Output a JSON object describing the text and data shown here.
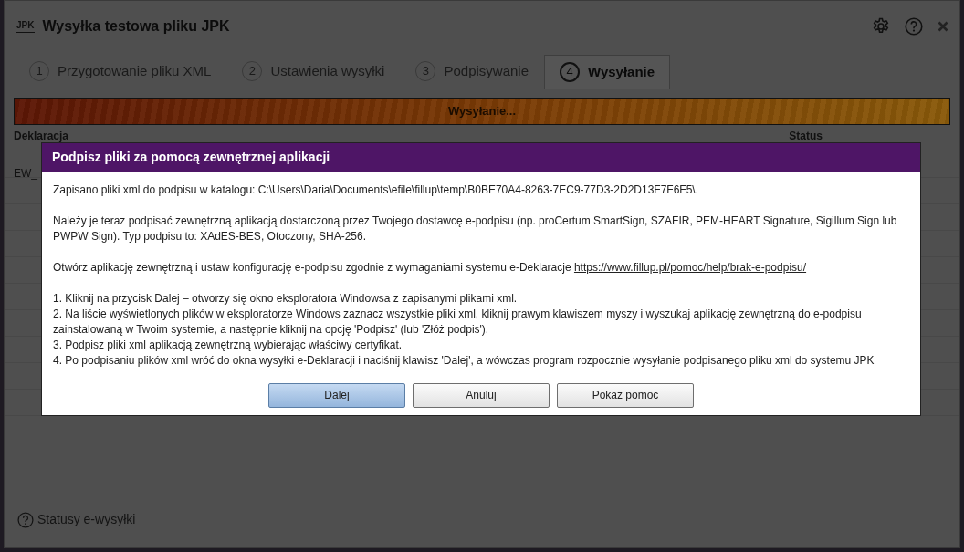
{
  "window": {
    "logo": "JPK",
    "title": "Wysyłka testowa pliku JPK"
  },
  "tabs": [
    {
      "number": "1",
      "label": "Przygotowanie pliku XML",
      "selected": false
    },
    {
      "number": "2",
      "label": "Ustawienia wysyłki",
      "selected": false
    },
    {
      "number": "3",
      "label": "Podpisywanie",
      "selected": false
    },
    {
      "number": "4",
      "label": "Wysyłanie",
      "selected": true
    }
  ],
  "progress": {
    "label": "Wysyłanie...",
    "level": 1
  },
  "table": {
    "columns": [
      "Deklaracja",
      "Status"
    ],
    "rows": [
      {
        "column_1": "EW_"
      }
    ]
  },
  "footer_link": "Statusy e-wysyłki",
  "dialog": {
    "title": "Podpisz pliki za pomocą zewnętrznej aplikacji",
    "paragraphs": [
      {
        "text": "Zapisano pliki xml do podpisu w katalogu: C:\\Users\\Daria\\Documents\\efile\\fillup\\temp\\B0BE70A4-8263-7EC9-77D3-2D2D13F7F6F5\\."
      },
      {
        "text": "Należy je teraz podpisać zewnętrzną aplikacją dostarczoną przez Twojego dostawcę e-podpisu (np. proCertum SmartSign, SZAFIR, PEM-HEART Signature, Sigillum Sign lub PWPW Sign). Typ podpisu to: XAdES-BES, Otoczony, SHA-256."
      },
      {
        "text": "Otwórz aplikację zewnętrzną i ustaw konfigurację e-podpisu zgodnie z wymaganiami systemu e-Deklaracje",
        "link": "https://www.fillup.pl/pomoc/help/brak-e-podpisu/"
      }
    ],
    "steps": [
      "1. Kliknij na przycisk Dalej – otworzy się okno eksploratora Windowsa z zapisanymi plikami xml.",
      "2. Na liście wyświetlonych plików w eksploratorze Windows zaznacz wszystkie pliki xml, kliknij prawym klawiszem myszy i wyszukaj aplikację zewnętrzną do e-podpisu zainstalowaną w Twoim systemie, a następnie kliknij na opcję 'Podpisz' (lub 'Złóż podpis').",
      "3. Podpisz pliki xml aplikacją zewnętrzną wybierając właściwy certyfikat.",
      "4. Po podpisaniu plików xml wróć do okna wysyłki e-Deklaracji i naciśnij klawisz 'Dalej', a wówczas program rozpocznie wysyłanie podpisanego pliku xml do systemu JPK"
    ],
    "buttons": [
      {
        "label": "Dalej",
        "primary": true
      },
      {
        "label": "Anuluj",
        "primary": false
      },
      {
        "label": "Pokaż pomoc",
        "primary": false
      }
    ]
  }
}
